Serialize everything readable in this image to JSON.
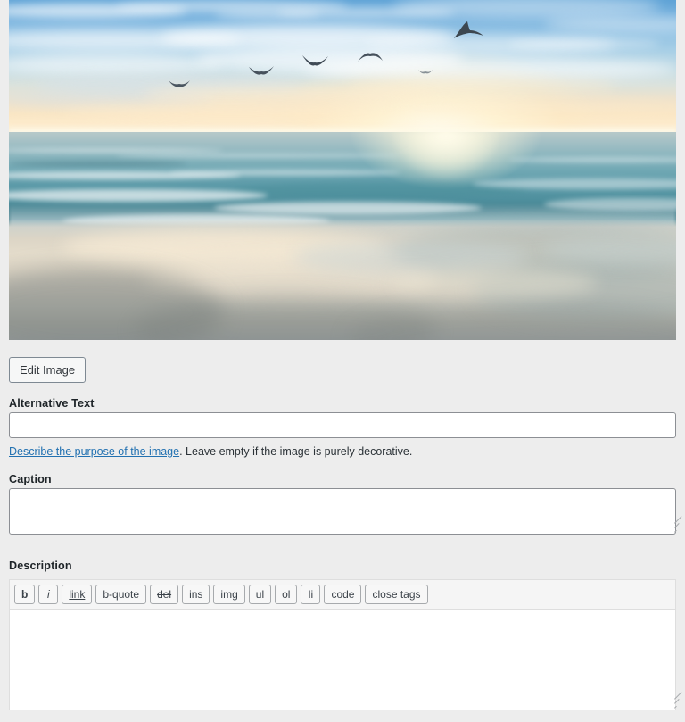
{
  "media": {
    "image_alt_description": "Ocean sunset over a sandy beach with seagulls flying in the sky",
    "frame_name": "attachment-image-preview"
  },
  "actions": {
    "edit_image_label": "Edit Image"
  },
  "fields": {
    "alt_text": {
      "label": "Alternative Text",
      "value": "",
      "placeholder": ""
    },
    "alt_help": {
      "link_text": "Describe the purpose of the image",
      "rest_text": ". Leave empty if the image is purely decorative."
    },
    "caption": {
      "label": "Caption",
      "value": "",
      "placeholder": ""
    },
    "description": {
      "label": "Description",
      "value": "",
      "placeholder": ""
    }
  },
  "quicktags": [
    {
      "name": "bold",
      "label": "b",
      "style": "b"
    },
    {
      "name": "italic",
      "label": "i",
      "style": "i"
    },
    {
      "name": "link",
      "label": "link",
      "style": "u"
    },
    {
      "name": "blockquote",
      "label": "b-quote",
      "style": ""
    },
    {
      "name": "del",
      "label": "del",
      "style": "s"
    },
    {
      "name": "ins",
      "label": "ins",
      "style": ""
    },
    {
      "name": "img",
      "label": "img",
      "style": ""
    },
    {
      "name": "ul",
      "label": "ul",
      "style": ""
    },
    {
      "name": "ol",
      "label": "ol",
      "style": ""
    },
    {
      "name": "li",
      "label": "li",
      "style": ""
    },
    {
      "name": "code",
      "label": "code",
      "style": ""
    },
    {
      "name": "close-tags",
      "label": "close tags",
      "style": ""
    }
  ],
  "colors": {
    "page_background": "#ededed",
    "link": "#2271b1",
    "button_border": "#7e8993",
    "input_border": "#8c8f94",
    "toolbar_background": "#f5f5f5",
    "text": "#1d2327"
  }
}
